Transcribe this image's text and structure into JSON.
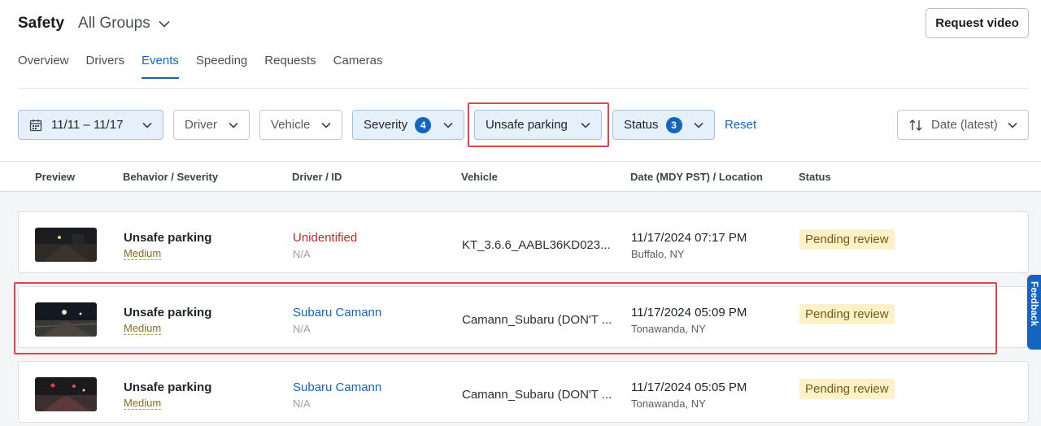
{
  "header": {
    "title": "Safety",
    "group": "All Groups",
    "request_button": "Request video"
  },
  "tabs": [
    {
      "label": "Overview",
      "active": false
    },
    {
      "label": "Drivers",
      "active": false
    },
    {
      "label": "Events",
      "active": true
    },
    {
      "label": "Speeding",
      "active": false
    },
    {
      "label": "Requests",
      "active": false
    },
    {
      "label": "Cameras",
      "active": false
    }
  ],
  "filters": {
    "date_range": "11/11 – 11/17",
    "driver": "Driver",
    "vehicle": "Vehicle",
    "severity": {
      "label": "Severity",
      "count": "4"
    },
    "behavior": "Unsafe parking",
    "status": {
      "label": "Status",
      "count": "3"
    },
    "reset": "Reset",
    "sort": "Date (latest)"
  },
  "table": {
    "columns": [
      "Preview",
      "Behavior / Severity",
      "Driver / ID",
      "Vehicle",
      "Date (MDY PST) / Location",
      "Status"
    ],
    "rows": [
      {
        "behavior": "Unsafe parking",
        "severity": "Medium",
        "driver": "Unidentified",
        "driver_id": "N/A",
        "vehicle": "KT_3.6.6_AABL36KD023...",
        "date": "11/17/2024 07:17 PM",
        "location": "Buffalo, NY",
        "status": "Pending review"
      },
      {
        "behavior": "Unsafe parking",
        "severity": "Medium",
        "driver": "Subaru Camann",
        "driver_id": "N/A",
        "vehicle": "Camann_Subaru (DON'T ...",
        "date": "11/17/2024 05:09 PM",
        "location": "Tonawanda, NY",
        "status": "Pending review"
      },
      {
        "behavior": "Unsafe parking",
        "severity": "Medium",
        "driver": "Subaru Camann",
        "driver_id": "N/A",
        "vehicle": "Camann_Subaru (DON'T ...",
        "date": "11/17/2024 05:05 PM",
        "location": "Tonawanda, NY",
        "status": "Pending review"
      }
    ]
  },
  "feedback_tab": "Feedback",
  "colors": {
    "accent": "#1565c0",
    "highlight": "#e0474c",
    "pending_bg": "#fdf1c9",
    "unidentified": "#c62828"
  }
}
